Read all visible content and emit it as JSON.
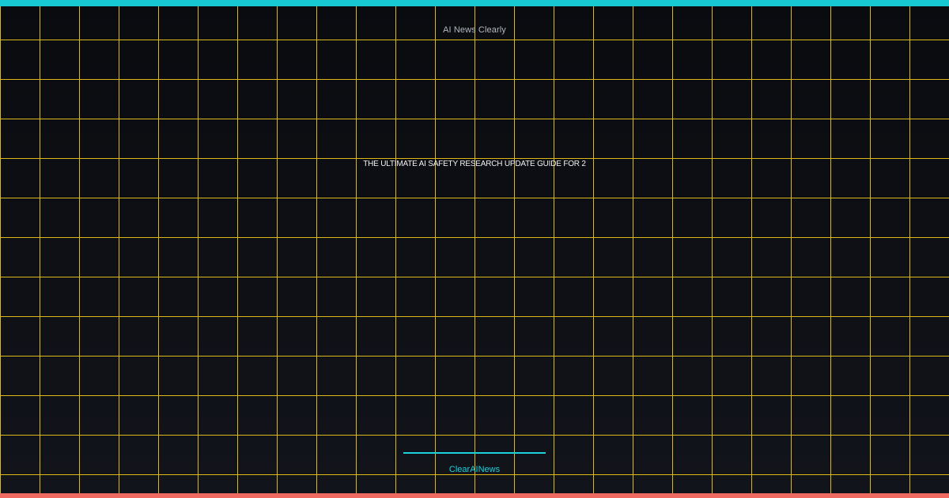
{
  "header": {
    "brand": "AI News Clearly"
  },
  "main": {
    "headline": "THE ULTIMATE AI SAFETY RESEARCH UPDATE GUIDE FOR 2"
  },
  "footer": {
    "brand": "ClearAINews"
  },
  "colors": {
    "background": "#0b0c10",
    "grid": "#e8c21a",
    "top_bar": "#17c7d1",
    "bottom_bar": "#ef6a61",
    "accent": "#19d2de",
    "brand_text": "#b4b8c1",
    "headline_text": "#f1f2f4"
  }
}
